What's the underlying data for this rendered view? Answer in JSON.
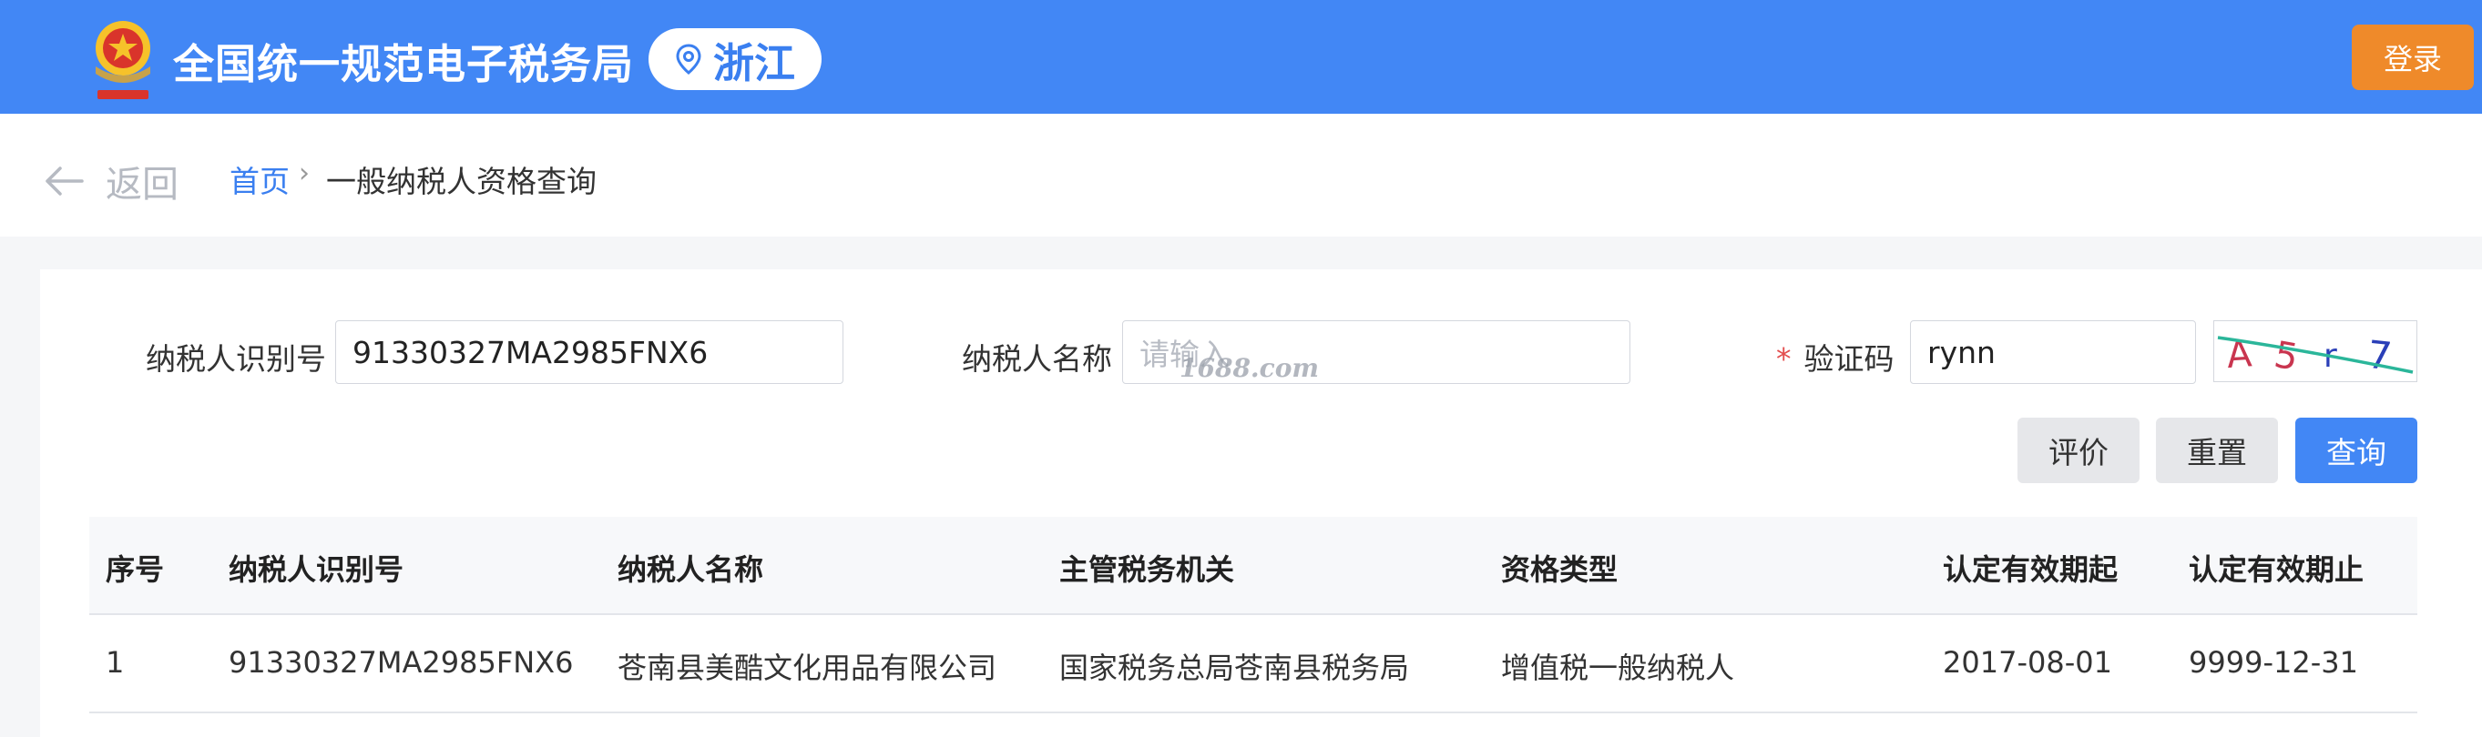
{
  "header": {
    "site_title": "全国统一规范电子税务局",
    "region": "浙江",
    "login_label": "登录",
    "emblem_icon": "tax-emblem-icon",
    "location_icon": "location-pin-icon"
  },
  "breadcrumb": {
    "back_label": "返回",
    "home": "首页",
    "separator": "›",
    "current": "一般纳税人资格查询"
  },
  "form": {
    "taxpayer_id_label": "纳税人识别号",
    "taxpayer_id_value": "91330327MA2985FNX6",
    "taxpayer_name_label": "纳税人名称",
    "taxpayer_name_placeholder": "请输入",
    "required_mark": "*",
    "captcha_label": "验证码",
    "captcha_value": "rynn",
    "captcha_image_text": "A5r7"
  },
  "buttons": {
    "evaluate": "评价",
    "reset": "重置",
    "query": "查询"
  },
  "table": {
    "columns": [
      "序号",
      "纳税人识别号",
      "纳税人名称",
      "主管税务机关",
      "资格类型",
      "认定有效期起",
      "认定有效期止"
    ],
    "rows": [
      [
        "1",
        "91330327MA2985FNX6",
        "苍南县美酷文化用品有限公司",
        "国家税务总局苍南县税务局",
        "增值税一般纳税人",
        "2017-08-01",
        "9999-12-31"
      ]
    ]
  },
  "watermark": "1688.com",
  "colors": {
    "header_bg": "#4287f5",
    "login_bg": "#ef8a2a",
    "primary": "#4287f5",
    "link": "#3a7ff0"
  }
}
